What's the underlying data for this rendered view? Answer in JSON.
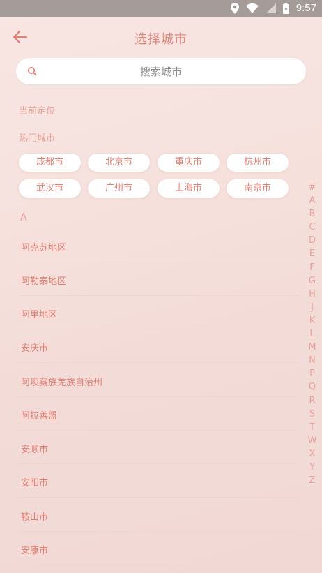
{
  "statusbar": {
    "time": "9:57",
    "icons": [
      "location-icon",
      "wifi-icon",
      "signal-icon",
      "battery-icon"
    ]
  },
  "header": {
    "title": "选择城市",
    "back_icon": "back-arrow-icon"
  },
  "search": {
    "placeholder": "搜索城市"
  },
  "sections": {
    "current_location": "当前定位",
    "hot_cities": "热门城市"
  },
  "hot_cities": [
    "成都市",
    "北京市",
    "重庆市",
    "杭州市",
    "武汉市",
    "广州市",
    "上海市",
    "南京市"
  ],
  "group_letter": "A",
  "cities": [
    "阿克苏地区",
    "阿勒泰地区",
    "阿里地区",
    "安庆市",
    "阿坝藏族羌族自治州",
    "阿拉善盟",
    "安顺市",
    "安阳市",
    "鞍山市",
    "安康市"
  ],
  "index_letters": [
    "#",
    "A",
    "B",
    "C",
    "D",
    "E",
    "F",
    "G",
    "H",
    "J",
    "K",
    "L",
    "M",
    "N",
    "P",
    "Q",
    "R",
    "S",
    "T",
    "W",
    "X",
    "Y",
    "Z"
  ],
  "colors": {
    "accent": "#e27f73",
    "muted": "#e8a39a",
    "statusbar": "#a59b99"
  }
}
